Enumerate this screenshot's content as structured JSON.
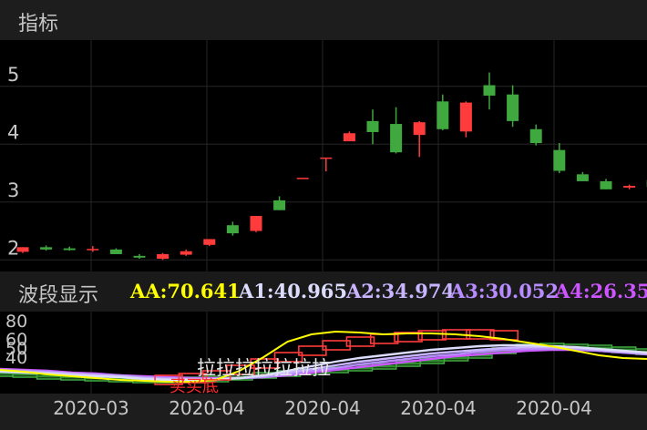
{
  "header": {
    "title": "指标"
  },
  "band": {
    "name": "波段显示",
    "indicators": [
      {
        "label": "AA:70.641",
        "color": "#ffff00"
      },
      {
        "label": "A1:40.965",
        "color": "#dcdcff"
      },
      {
        "label": "A2:34.974",
        "color": "#c8b4ff"
      },
      {
        "label": "A3:30.052",
        "color": "#b88cff"
      },
      {
        "label": "A4:26.35",
        "color": "#cc55ff"
      }
    ]
  },
  "sub_labels": {
    "overlay": "拉拉拉拉拉拉拉",
    "bottom": "买买底"
  },
  "x_axis": {
    "dates": [
      "2020-03",
      "2020-04",
      "2020-04",
      "2020-04",
      "2020-04"
    ]
  },
  "colors": {
    "up": "#ff3b3b",
    "down": "#3fa83f",
    "grid": "#262626",
    "background": "#000000",
    "panel": "#1d1d1d"
  },
  "chart_data": [
    {
      "type": "candlestick",
      "title": "",
      "ylim": [
        1.8,
        5.8
      ],
      "y_ticks": [
        2,
        3,
        4,
        5
      ],
      "grid": true,
      "candles": [
        {
          "o": 2.14,
          "h": 2.22,
          "l": 2.12,
          "c": 2.22
        },
        {
          "o": 2.22,
          "h": 2.25,
          "l": 2.16,
          "c": 2.18
        },
        {
          "o": 2.2,
          "h": 2.23,
          "l": 2.16,
          "c": 2.17
        },
        {
          "o": 2.17,
          "h": 2.24,
          "l": 2.14,
          "c": 2.19
        },
        {
          "o": 2.18,
          "h": 2.2,
          "l": 2.1,
          "c": 2.1
        },
        {
          "o": 2.07,
          "h": 2.1,
          "l": 2.02,
          "c": 2.04
        },
        {
          "o": 2.02,
          "h": 2.12,
          "l": 2.0,
          "c": 2.1
        },
        {
          "o": 2.09,
          "h": 2.18,
          "l": 2.07,
          "c": 2.15
        },
        {
          "o": 2.26,
          "h": 2.36,
          "l": 2.24,
          "c": 2.36
        },
        {
          "o": 2.6,
          "h": 2.66,
          "l": 2.42,
          "c": 2.46
        },
        {
          "o": 2.5,
          "h": 2.76,
          "l": 2.48,
          "c": 2.76
        },
        {
          "o": 3.03,
          "h": 3.1,
          "l": 2.86,
          "c": 2.86
        },
        {
          "o": 3.41,
          "h": 3.41,
          "l": 3.41,
          "c": 3.42
        },
        {
          "o": 3.77,
          "h": 3.77,
          "l": 3.53,
          "c": 3.77
        },
        {
          "o": 4.05,
          "h": 4.22,
          "l": 4.06,
          "c": 4.19
        },
        {
          "o": 4.4,
          "h": 4.6,
          "l": 4.0,
          "c": 4.21
        },
        {
          "o": 4.35,
          "h": 4.64,
          "l": 3.84,
          "c": 3.86
        },
        {
          "o": 4.16,
          "h": 4.4,
          "l": 3.78,
          "c": 4.38
        },
        {
          "o": 4.74,
          "h": 4.86,
          "l": 4.24,
          "c": 4.26
        },
        {
          "o": 4.22,
          "h": 4.74,
          "l": 4.12,
          "c": 4.72
        },
        {
          "o": 5.02,
          "h": 5.24,
          "l": 4.6,
          "c": 4.84
        },
        {
          "o": 4.86,
          "h": 5.02,
          "l": 4.3,
          "c": 4.4
        },
        {
          "o": 4.26,
          "h": 4.34,
          "l": 3.98,
          "c": 4.02
        },
        {
          "o": 3.9,
          "h": 4.02,
          "l": 3.5,
          "c": 3.54
        },
        {
          "o": 3.48,
          "h": 3.52,
          "l": 3.36,
          "c": 3.36
        },
        {
          "o": 3.36,
          "h": 3.4,
          "l": 3.22,
          "c": 3.22
        },
        {
          "o": 3.25,
          "h": 3.3,
          "l": 3.22,
          "c": 3.28
        },
        {
          "o": 3.38,
          "h": 3.42,
          "l": 3.22,
          "c": 3.26
        }
      ]
    },
    {
      "type": "line",
      "title": "",
      "ylim": [
        0,
        90
      ],
      "y_ticks": [
        40,
        50,
        60,
        80
      ],
      "series": [
        {
          "name": "AA",
          "color": "#ffff00",
          "values": [
            26,
            24,
            21,
            19,
            17,
            15,
            14,
            13,
            13,
            15,
            25,
            40,
            57,
            65,
            68,
            67,
            65,
            66,
            66,
            65,
            63,
            60,
            56,
            52,
            47,
            42,
            39,
            38
          ]
        },
        {
          "name": "A1",
          "color": "#dcdcff",
          "values": [
            24,
            23,
            22,
            20,
            19,
            18,
            16,
            15,
            15,
            15,
            17,
            20,
            25,
            30,
            35,
            39,
            42,
            45,
            48,
            50,
            52,
            53,
            53,
            52,
            51,
            49,
            47,
            45
          ]
        },
        {
          "name": "A2",
          "color": "#c8b4ff",
          "values": [
            25,
            24,
            23,
            22,
            20,
            19,
            17,
            16,
            16,
            16,
            17,
            19,
            23,
            27,
            31,
            35,
            38,
            41,
            44,
            46,
            48,
            50,
            51,
            51,
            50,
            48,
            46,
            44
          ]
        },
        {
          "name": "A3",
          "color": "#b88cff",
          "values": [
            26,
            25,
            24,
            22,
            21,
            20,
            18,
            17,
            16,
            16,
            17,
            18,
            21,
            25,
            28,
            32,
            35,
            38,
            41,
            43,
            46,
            48,
            49,
            49,
            49,
            47,
            45,
            43
          ]
        },
        {
          "name": "A4",
          "color": "#cc55ff",
          "values": [
            27,
            26,
            25,
            23,
            22,
            20,
            19,
            18,
            17,
            17,
            17,
            18,
            20,
            23,
            26,
            29,
            32,
            35,
            38,
            41,
            43,
            45,
            47,
            48,
            48,
            47,
            45,
            44
          ]
        }
      ],
      "bands": [
        {
          "color": "green",
          "values": [
            22,
            21,
            19,
            18,
            17,
            16,
            15,
            15,
            15,
            16,
            18,
            20,
            22,
            24,
            26,
            28,
            30,
            33,
            36,
            39,
            42,
            47,
            51,
            52,
            51,
            50,
            48,
            46
          ]
        },
        {
          "color": "red",
          "values": [
            null,
            null,
            null,
            null,
            null,
            null,
            null,
            15,
            17,
            20,
            26,
            33,
            40,
            47,
            53,
            57,
            60,
            62,
            64,
            65,
            65,
            64,
            null,
            null,
            null,
            null,
            null,
            null
          ]
        }
      ]
    }
  ]
}
